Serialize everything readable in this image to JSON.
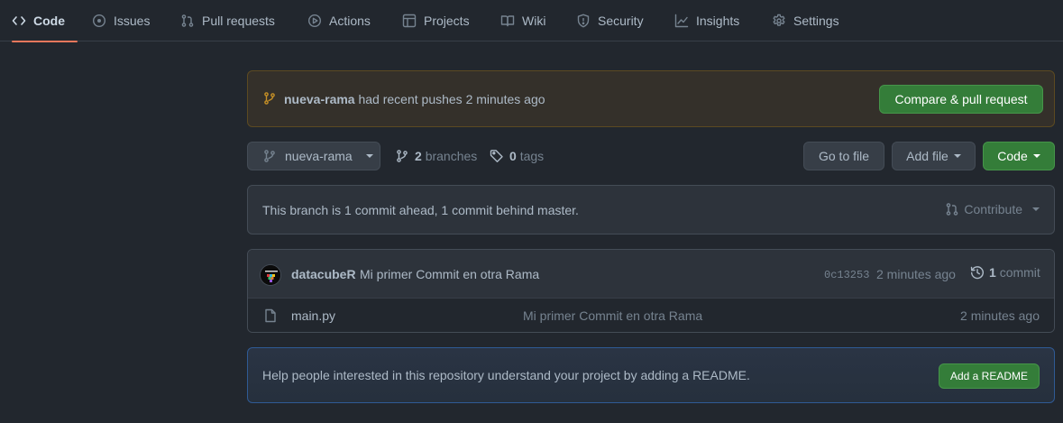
{
  "nav": {
    "tabs": [
      {
        "label": "Code",
        "icon": "code-icon",
        "selected": true
      },
      {
        "label": "Issues",
        "icon": "issue-opened-icon"
      },
      {
        "label": "Pull requests",
        "icon": "git-pull-request-icon"
      },
      {
        "label": "Actions",
        "icon": "play-icon"
      },
      {
        "label": "Projects",
        "icon": "table-icon"
      },
      {
        "label": "Wiki",
        "icon": "book-icon"
      },
      {
        "label": "Security",
        "icon": "shield-icon"
      },
      {
        "label": "Insights",
        "icon": "graph-icon"
      },
      {
        "label": "Settings",
        "icon": "gear-icon"
      }
    ]
  },
  "push_banner": {
    "branch": "nueva-rama",
    "message": "had recent pushes 2 minutes ago",
    "button_label": "Compare & pull request"
  },
  "file_nav": {
    "branch_label": "nueva-rama",
    "branches_count": "2",
    "branches_label": "branches",
    "tags_count": "0",
    "tags_label": "tags",
    "goto_file_label": "Go to file",
    "add_file_label": "Add file",
    "code_label": "Code"
  },
  "branch_info": {
    "text": "This branch is 1 commit ahead, 1 commit behind master.",
    "contribute_label": "Contribute"
  },
  "latest_commit": {
    "author": "datacubeR",
    "message": "Mi primer Commit en otra Rama",
    "sha": "0c13253",
    "age": "2 minutes ago",
    "count": "1",
    "count_label": "commit"
  },
  "files": [
    {
      "name": "main.py",
      "commit_message": "Mi primer Commit en otra Rama",
      "age": "2 minutes ago"
    }
  ],
  "readme_prompt": {
    "text": "Help people interested in this repository understand your project by adding a README.",
    "button_label": "Add a README"
  },
  "colors": {
    "background": "#22272e",
    "selected_tab_underline": "#ec775c",
    "banner_branch_icon": "#c69026",
    "green_button": "#347d39"
  }
}
